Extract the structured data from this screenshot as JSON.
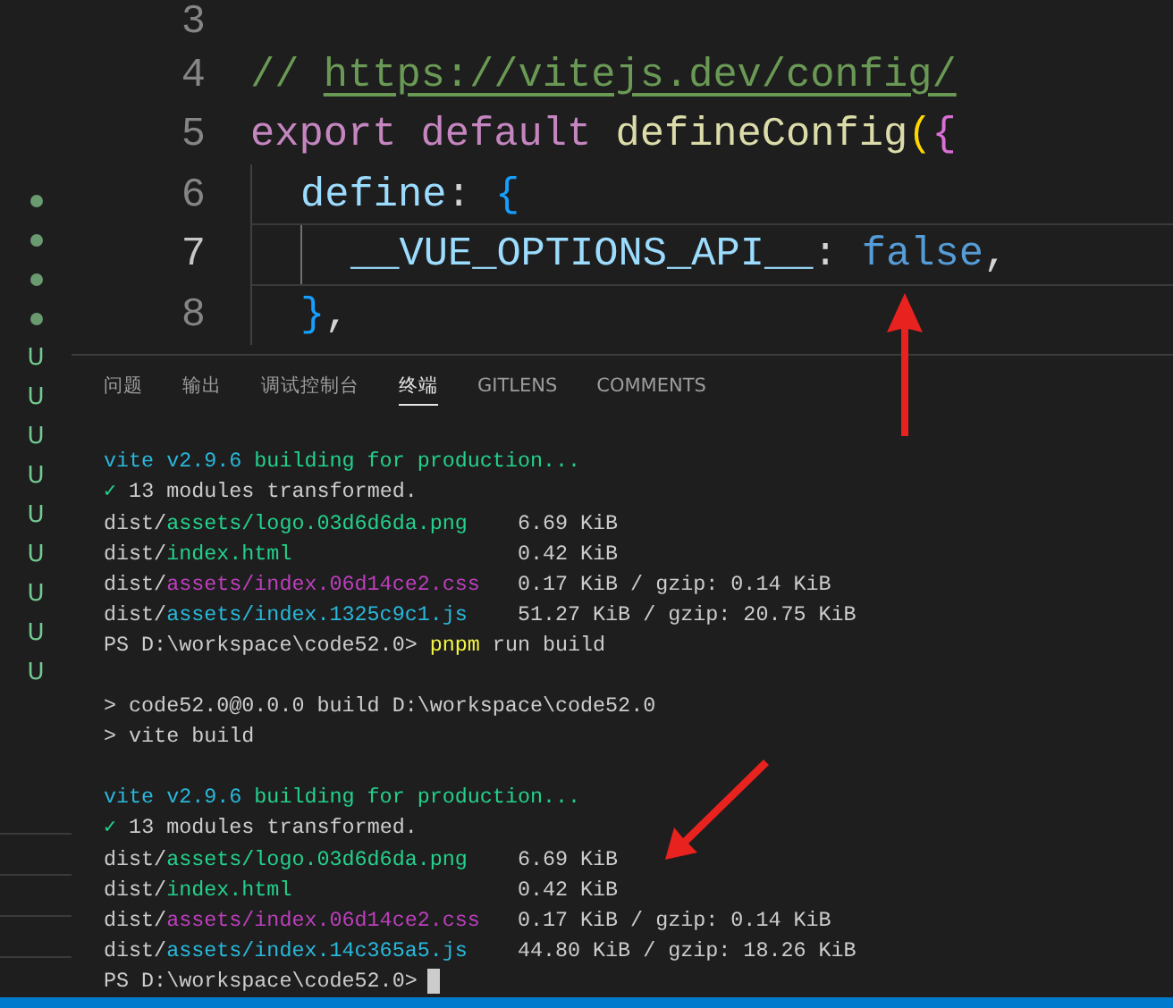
{
  "gutter": {
    "markers": [
      {
        "kind": "dot"
      },
      {
        "kind": "dot"
      },
      {
        "kind": "dot"
      },
      {
        "kind": "dot"
      },
      {
        "kind": "letter",
        "label": "U"
      },
      {
        "kind": "letter",
        "label": "U"
      },
      {
        "kind": "letter",
        "label": "U"
      },
      {
        "kind": "letter",
        "label": "U"
      },
      {
        "kind": "letter",
        "label": "U"
      },
      {
        "kind": "letter",
        "label": "U"
      },
      {
        "kind": "letter",
        "label": "U"
      },
      {
        "kind": "letter",
        "label": "U"
      },
      {
        "kind": "letter",
        "label": "U"
      }
    ]
  },
  "editor": {
    "lines": [
      {
        "number": "3",
        "active": false
      },
      {
        "number": "4",
        "active": false,
        "tokens": [
          {
            "text": "// ",
            "kind": "comment"
          },
          {
            "text": "https://vitejs.dev/config/",
            "kind": "link"
          }
        ]
      },
      {
        "number": "5",
        "active": false,
        "tokens": [
          {
            "text": "export default",
            "kind": "keyword"
          },
          {
            "text": "defineConfig",
            "kind": "function"
          },
          {
            "text": "(",
            "kind": "bracket1"
          },
          {
            "text": "{",
            "kind": "bracket2"
          }
        ],
        "children": [
          {
            "number": "6",
            "active": false,
            "tokens": [
              {
                "text": "define",
                "kind": "property"
              },
              {
                "text": ": ",
                "kind": "punct"
              },
              {
                "text": "{",
                "kind": "bracket3"
              }
            ],
            "children": [
              {
                "number": "7",
                "active": true,
                "tokens": [
                  {
                    "text": "__VUE_OPTIONS_API__",
                    "kind": "property"
                  },
                  {
                    "text": ": ",
                    "kind": "punct"
                  },
                  {
                    "text": "false",
                    "kind": "constant"
                  },
                  {
                    "text": ",",
                    "kind": "punct"
                  }
                ]
              }
            ]
          },
          {
            "number": "8",
            "active": false,
            "tokens": [
              {
                "text": "}",
                "kind": "bracket3"
              },
              {
                "text": ",",
                "kind": "punct"
              }
            ]
          }
        ]
      }
    ]
  },
  "panel": {
    "tabs": [
      {
        "label": "问题",
        "selected": false
      },
      {
        "label": "输出",
        "selected": false
      },
      {
        "label": "调试控制台",
        "selected": false
      },
      {
        "label": "终端",
        "selected": true
      },
      {
        "label": "GITLENS",
        "selected": false
      },
      {
        "label": "COMMENTS",
        "selected": false
      }
    ],
    "terminal": [
      {
        "kind": "text",
        "segments": [
          {
            "text": "vite v2.9.6 ",
            "kind": "cyan"
          },
          {
            "text": "building for production...",
            "kind": "green"
          }
        ]
      },
      {
        "kind": "text",
        "segments": [
          {
            "text": "✓",
            "kind": "green"
          },
          {
            "text": " 13 modules transformed.",
            "kind": "plain"
          }
        ]
      },
      {
        "kind": "file",
        "segments": [
          {
            "text": "dist/",
            "kind": "plain"
          },
          {
            "text": "assets/logo.03d6d6da.png",
            "kind": "green"
          }
        ],
        "size": "6.69 KiB"
      },
      {
        "kind": "file",
        "segments": [
          {
            "text": "dist/",
            "kind": "plain"
          },
          {
            "text": "index.html",
            "kind": "green"
          }
        ],
        "size": "0.42 KiB"
      },
      {
        "kind": "file",
        "segments": [
          {
            "text": "dist/",
            "kind": "plain"
          },
          {
            "text": "assets/index.06d14ce2.css",
            "kind": "magenta"
          }
        ],
        "size": "0.17 KiB / gzip: 0.14 KiB"
      },
      {
        "kind": "file",
        "segments": [
          {
            "text": "dist/",
            "kind": "plain"
          },
          {
            "text": "assets/index.1325c9c1.js",
            "kind": "cyan"
          }
        ],
        "size": "51.27 KiB / gzip: 20.75 KiB"
      },
      {
        "kind": "text",
        "segments": [
          {
            "text": "PS D:\\workspace\\code52.0> ",
            "kind": "plain"
          },
          {
            "text": "pnpm",
            "kind": "yellow"
          },
          {
            "text": " run build",
            "kind": "plain"
          }
        ]
      },
      {
        "kind": "blank"
      },
      {
        "kind": "text",
        "segments": [
          {
            "text": "> code52.0@0.0.0 build D:\\workspace\\code52.0",
            "kind": "plain"
          }
        ]
      },
      {
        "kind": "text",
        "segments": [
          {
            "text": "> vite build",
            "kind": "plain"
          }
        ]
      },
      {
        "kind": "blank"
      },
      {
        "kind": "text",
        "segments": [
          {
            "text": "vite v2.9.6 ",
            "kind": "cyan"
          },
          {
            "text": "building for production...",
            "kind": "green"
          }
        ]
      },
      {
        "kind": "text",
        "segments": [
          {
            "text": "✓",
            "kind": "green"
          },
          {
            "text": " 13 modules transformed.",
            "kind": "plain"
          }
        ]
      },
      {
        "kind": "file",
        "segments": [
          {
            "text": "dist/",
            "kind": "plain"
          },
          {
            "text": "assets/logo.03d6d6da.png",
            "kind": "green"
          }
        ],
        "size": "6.69 KiB"
      },
      {
        "kind": "file",
        "segments": [
          {
            "text": "dist/",
            "kind": "plain"
          },
          {
            "text": "index.html",
            "kind": "green"
          }
        ],
        "size": "0.42 KiB"
      },
      {
        "kind": "file",
        "segments": [
          {
            "text": "dist/",
            "kind": "plain"
          },
          {
            "text": "assets/index.06d14ce2.css",
            "kind": "magenta"
          }
        ],
        "size": "0.17 KiB / gzip: 0.14 KiB"
      },
      {
        "kind": "file",
        "segments": [
          {
            "text": "dist/",
            "kind": "plain"
          },
          {
            "text": "assets/index.14c365a5.js",
            "kind": "cyan"
          }
        ],
        "size": "44.80 KiB / gzip: 18.26 KiB"
      },
      {
        "kind": "prompt",
        "text": "PS D:\\workspace\\code52.0>"
      }
    ]
  }
}
